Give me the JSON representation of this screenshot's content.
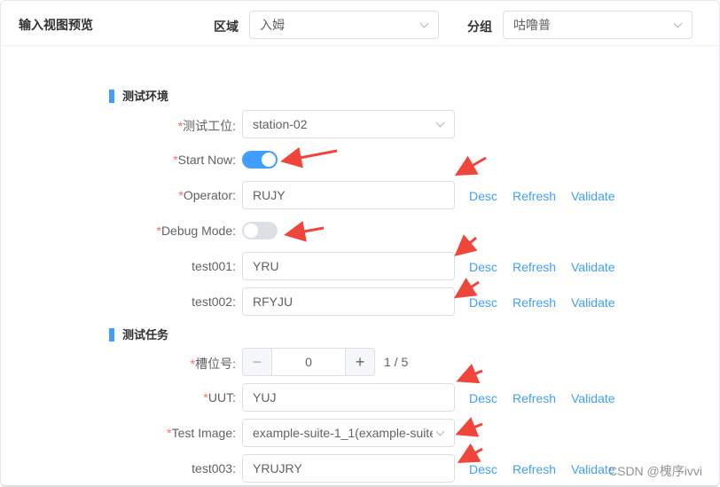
{
  "header": {
    "title": "输入视图预览",
    "region_label": "区域",
    "region_value": "入姆",
    "group_label": "分组",
    "group_value": "咕噜普"
  },
  "sections": [
    {
      "title": "测试环境"
    },
    {
      "title": "测试任务"
    }
  ],
  "links": {
    "desc": "Desc",
    "refresh": "Refresh",
    "validate": "Validate"
  },
  "fields": {
    "station": {
      "label": "测试工位:",
      "value": "station-02",
      "required": true
    },
    "start_now": {
      "label": "Start Now:",
      "on": true,
      "required": true
    },
    "operator": {
      "label": "Operator:",
      "value": "RUJY",
      "required": true
    },
    "debug_mode": {
      "label": "Debug Mode:",
      "on": false,
      "required": true
    },
    "test001": {
      "label": "test001:",
      "value": "YRU"
    },
    "test002": {
      "label": "test002:",
      "value": "RFYJU"
    },
    "slot": {
      "label": "槽位号:",
      "value": "0",
      "count": "1 / 5",
      "required": true,
      "minus": "−",
      "plus": "+"
    },
    "uut": {
      "label": "UUT:",
      "value": "YUJ",
      "required": true
    },
    "test_image": {
      "label": "Test Image:",
      "value": "example-suite-1_1(example-suite",
      "required": true
    },
    "test003": {
      "label": "test003:",
      "value": "YRUJRY"
    }
  },
  "required_mark": "*",
  "watermark": "CSDN @槐序ivvi",
  "colors": {
    "primary": "#409eff",
    "required": "#f56c6c",
    "annotation_arrow": "#f0453a"
  }
}
